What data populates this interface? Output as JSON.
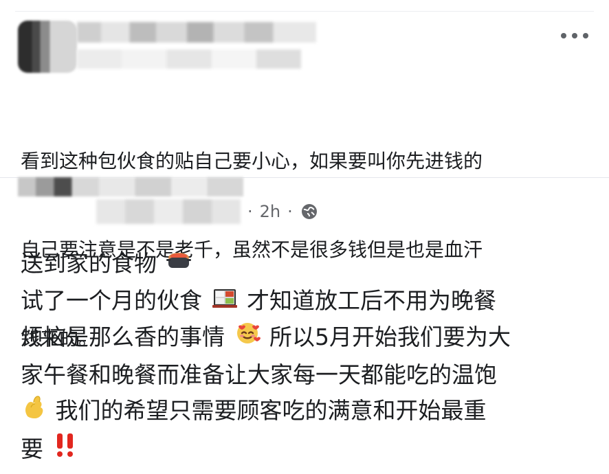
{
  "comment": {
    "lines": [
      "看到这种包伙食的贴自己要小心，如果要叫你先进钱的",
      "自己要注意是不是老千，虽然不是很多钱但是也是血汗",
      "钱来的。"
    ]
  },
  "post": {
    "time": "2h",
    "separator": "·",
    "lines": [
      {
        "text": "送到家的食物",
        "emoji": "pot-of-food-icon"
      },
      {
        "text_before": "试了一个月的伙食",
        "emoji": "bento-box-icon",
        "text_after": "才知道放工后不用为晚餐"
      },
      {
        "text_before": "烦恼是那么香的事情",
        "emoji": "smiling-face-with-hearts-icon",
        "text_after": "所以5月开始我们要为大"
      },
      {
        "text": "家午餐和晚餐而准备让大家每一天都能吃的温饱"
      },
      {
        "emoji": "pinching-hand-icon",
        "text_after": "我们的希望只需要顾客吃的满意和开始最重"
      },
      {
        "text_before": "要",
        "emoji": "double-exclamation-icon"
      }
    ]
  },
  "icons": {
    "more": "more-horizontal-icon",
    "privacy": "globe-icon"
  }
}
